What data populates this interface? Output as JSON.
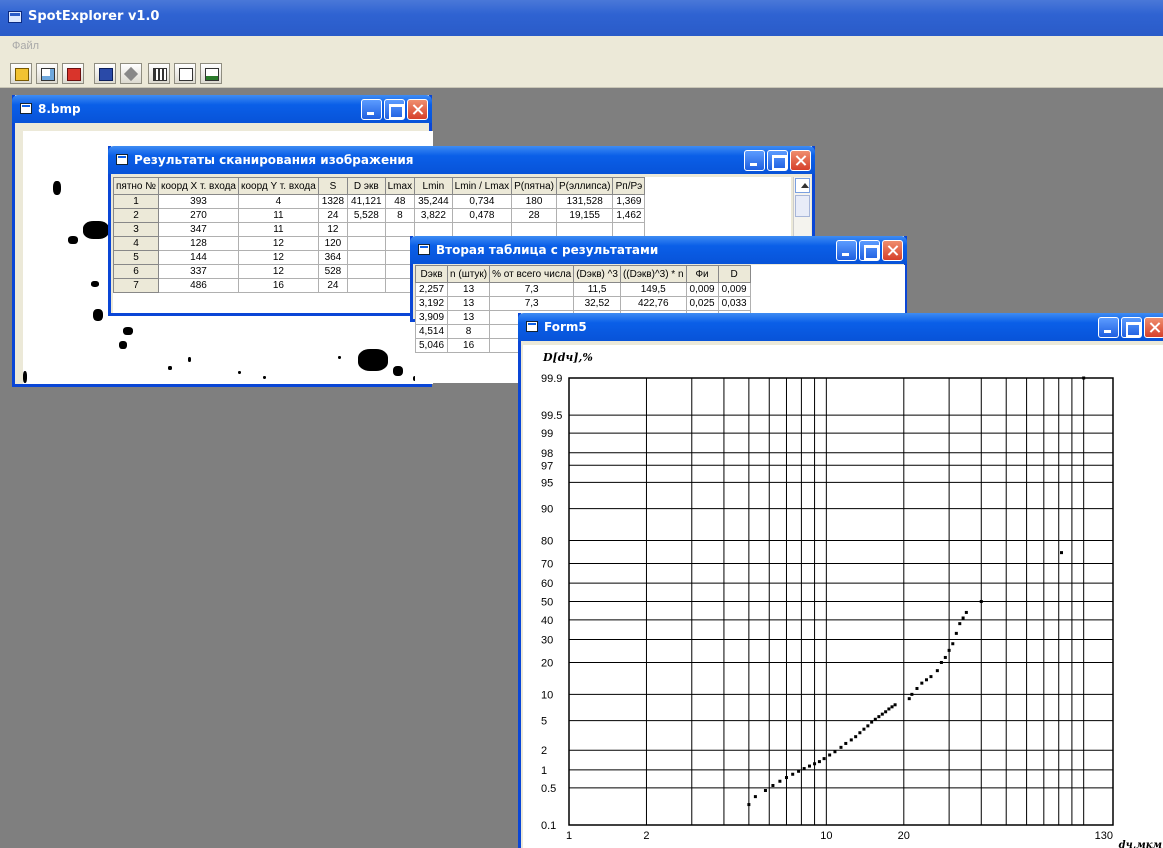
{
  "app": {
    "title": "SpotExplorer v1.0"
  },
  "menu": {
    "file": "Файл"
  },
  "toolbar": {
    "buttons": [
      "open-icon",
      "preview-icon",
      "red-tool-icon",
      "save-icon",
      "tools-icon",
      "table-icon",
      "checkbox-icon",
      "chart-icon"
    ]
  },
  "image_window": {
    "title": "8.bmp"
  },
  "results_window": {
    "title": "Результаты сканирования изображения",
    "columns": [
      "пятно №",
      "коорд X т. входа",
      "коорд Y т. входа",
      "S",
      "D экв",
      "Lmax",
      "Lmin",
      "Lmin / Lmax",
      "P(пятна)",
      "P(эллипса)",
      "Pп/Pэ"
    ],
    "rows": [
      [
        "1",
        "393",
        "4",
        "1328",
        "41,121",
        "48",
        "35,244",
        "0,734",
        "180",
        "131,528",
        "1,369"
      ],
      [
        "2",
        "270",
        "11",
        "24",
        "5,528",
        "8",
        "3,822",
        "0,478",
        "28",
        "19,155",
        "1,462"
      ],
      [
        "3",
        "347",
        "11",
        "12",
        "",
        "",
        "",
        "",
        "",
        "",
        ""
      ],
      [
        "4",
        "128",
        "12",
        "120",
        "",
        "",
        "",
        "",
        "",
        "",
        ""
      ],
      [
        "5",
        "144",
        "12",
        "364",
        "",
        "",
        "",
        "",
        "",
        "",
        ""
      ],
      [
        "6",
        "337",
        "12",
        "528",
        "",
        "",
        "",
        "",
        "",
        "",
        ""
      ],
      [
        "7",
        "486",
        "16",
        "24",
        "",
        "",
        "",
        "",
        "",
        "",
        ""
      ]
    ]
  },
  "second_window": {
    "title": "Вторая таблица с результатами",
    "columns": [
      "Dэкв",
      "n (штук)",
      "% от всего числа",
      "(Dэкв) ^3",
      "((Dэкв)^3) * n",
      "Фи",
      "D"
    ],
    "rows": [
      [
        "2,257",
        "13",
        "7,3",
        "11,5",
        "149,5",
        "0,009",
        "0,009"
      ],
      [
        "3,192",
        "13",
        "7,3",
        "32,52",
        "422,76",
        "0,025",
        "0,033"
      ],
      [
        "3,909",
        "13",
        "",
        "",
        "",
        "",
        ""
      ],
      [
        "4,514",
        "8",
        "",
        "",
        "",
        "",
        ""
      ],
      [
        "5,046",
        "16",
        "",
        "",
        "",
        "",
        ""
      ]
    ]
  },
  "form5": {
    "title": "Form5"
  },
  "chart_data": {
    "type": "scatter",
    "ylabel": "D[dч],%",
    "xlabel": "dч,мкм",
    "x_scale": "log",
    "y_scale": "probability",
    "xlim": [
      1,
      130
    ],
    "ylim": [
      0.1,
      99.9
    ],
    "x_tick_labels": [
      "1",
      "2",
      "10",
      "20",
      "130"
    ],
    "x_ticks": [
      1,
      2,
      10,
      20,
      130
    ],
    "y_tick_labels": [
      "99.9",
      "99.5",
      "99",
      "98",
      "97",
      "95",
      "90",
      "80",
      "70",
      "60",
      "50",
      "40",
      "30",
      "20",
      "10",
      "5",
      "2",
      "1",
      "0.5",
      "0.1"
    ],
    "y_ticks": [
      99.9,
      99.5,
      99,
      98,
      97,
      95,
      90,
      80,
      70,
      60,
      50,
      40,
      30,
      20,
      10,
      5,
      2,
      1,
      0.5,
      0.1
    ],
    "grid": true,
    "series": [
      {
        "points": [
          [
            5.0,
            0.25
          ],
          [
            5.3,
            0.35
          ],
          [
            5.8,
            0.45
          ],
          [
            6.2,
            0.55
          ],
          [
            6.6,
            0.65
          ],
          [
            7.0,
            0.75
          ],
          [
            7.4,
            0.85
          ],
          [
            7.8,
            0.95
          ],
          [
            8.2,
            1.05
          ],
          [
            8.6,
            1.15
          ],
          [
            9.0,
            1.25
          ],
          [
            9.4,
            1.35
          ],
          [
            9.8,
            1.5
          ],
          [
            10.3,
            1.7
          ],
          [
            10.8,
            1.9
          ],
          [
            11.4,
            2.2
          ],
          [
            11.9,
            2.5
          ],
          [
            12.5,
            2.8
          ],
          [
            13.0,
            3.1
          ],
          [
            13.5,
            3.5
          ],
          [
            14.0,
            3.9
          ],
          [
            14.5,
            4.3
          ],
          [
            15.0,
            4.8
          ],
          [
            15.5,
            5.2
          ],
          [
            16.0,
            5.6
          ],
          [
            16.5,
            6.0
          ],
          [
            17.0,
            6.4
          ],
          [
            17.5,
            6.9
          ],
          [
            18.0,
            7.3
          ],
          [
            18.5,
            7.7
          ],
          [
            21.0,
            9.0
          ],
          [
            21.5,
            10.0
          ],
          [
            22.5,
            11.5
          ],
          [
            23.5,
            13.0
          ],
          [
            24.5,
            14.0
          ],
          [
            25.5,
            15.0
          ],
          [
            27.0,
            17.0
          ],
          [
            28.0,
            20.0
          ],
          [
            29.0,
            22.0
          ],
          [
            30.0,
            25.0
          ],
          [
            31.0,
            28.0
          ],
          [
            32.0,
            33.0
          ],
          [
            33.0,
            38.0
          ],
          [
            34.0,
            41.0
          ],
          [
            35.0,
            44.0
          ],
          [
            40.0,
            50.0
          ],
          [
            82.0,
            75.0
          ],
          [
            100.0,
            99.9
          ]
        ]
      }
    ]
  }
}
